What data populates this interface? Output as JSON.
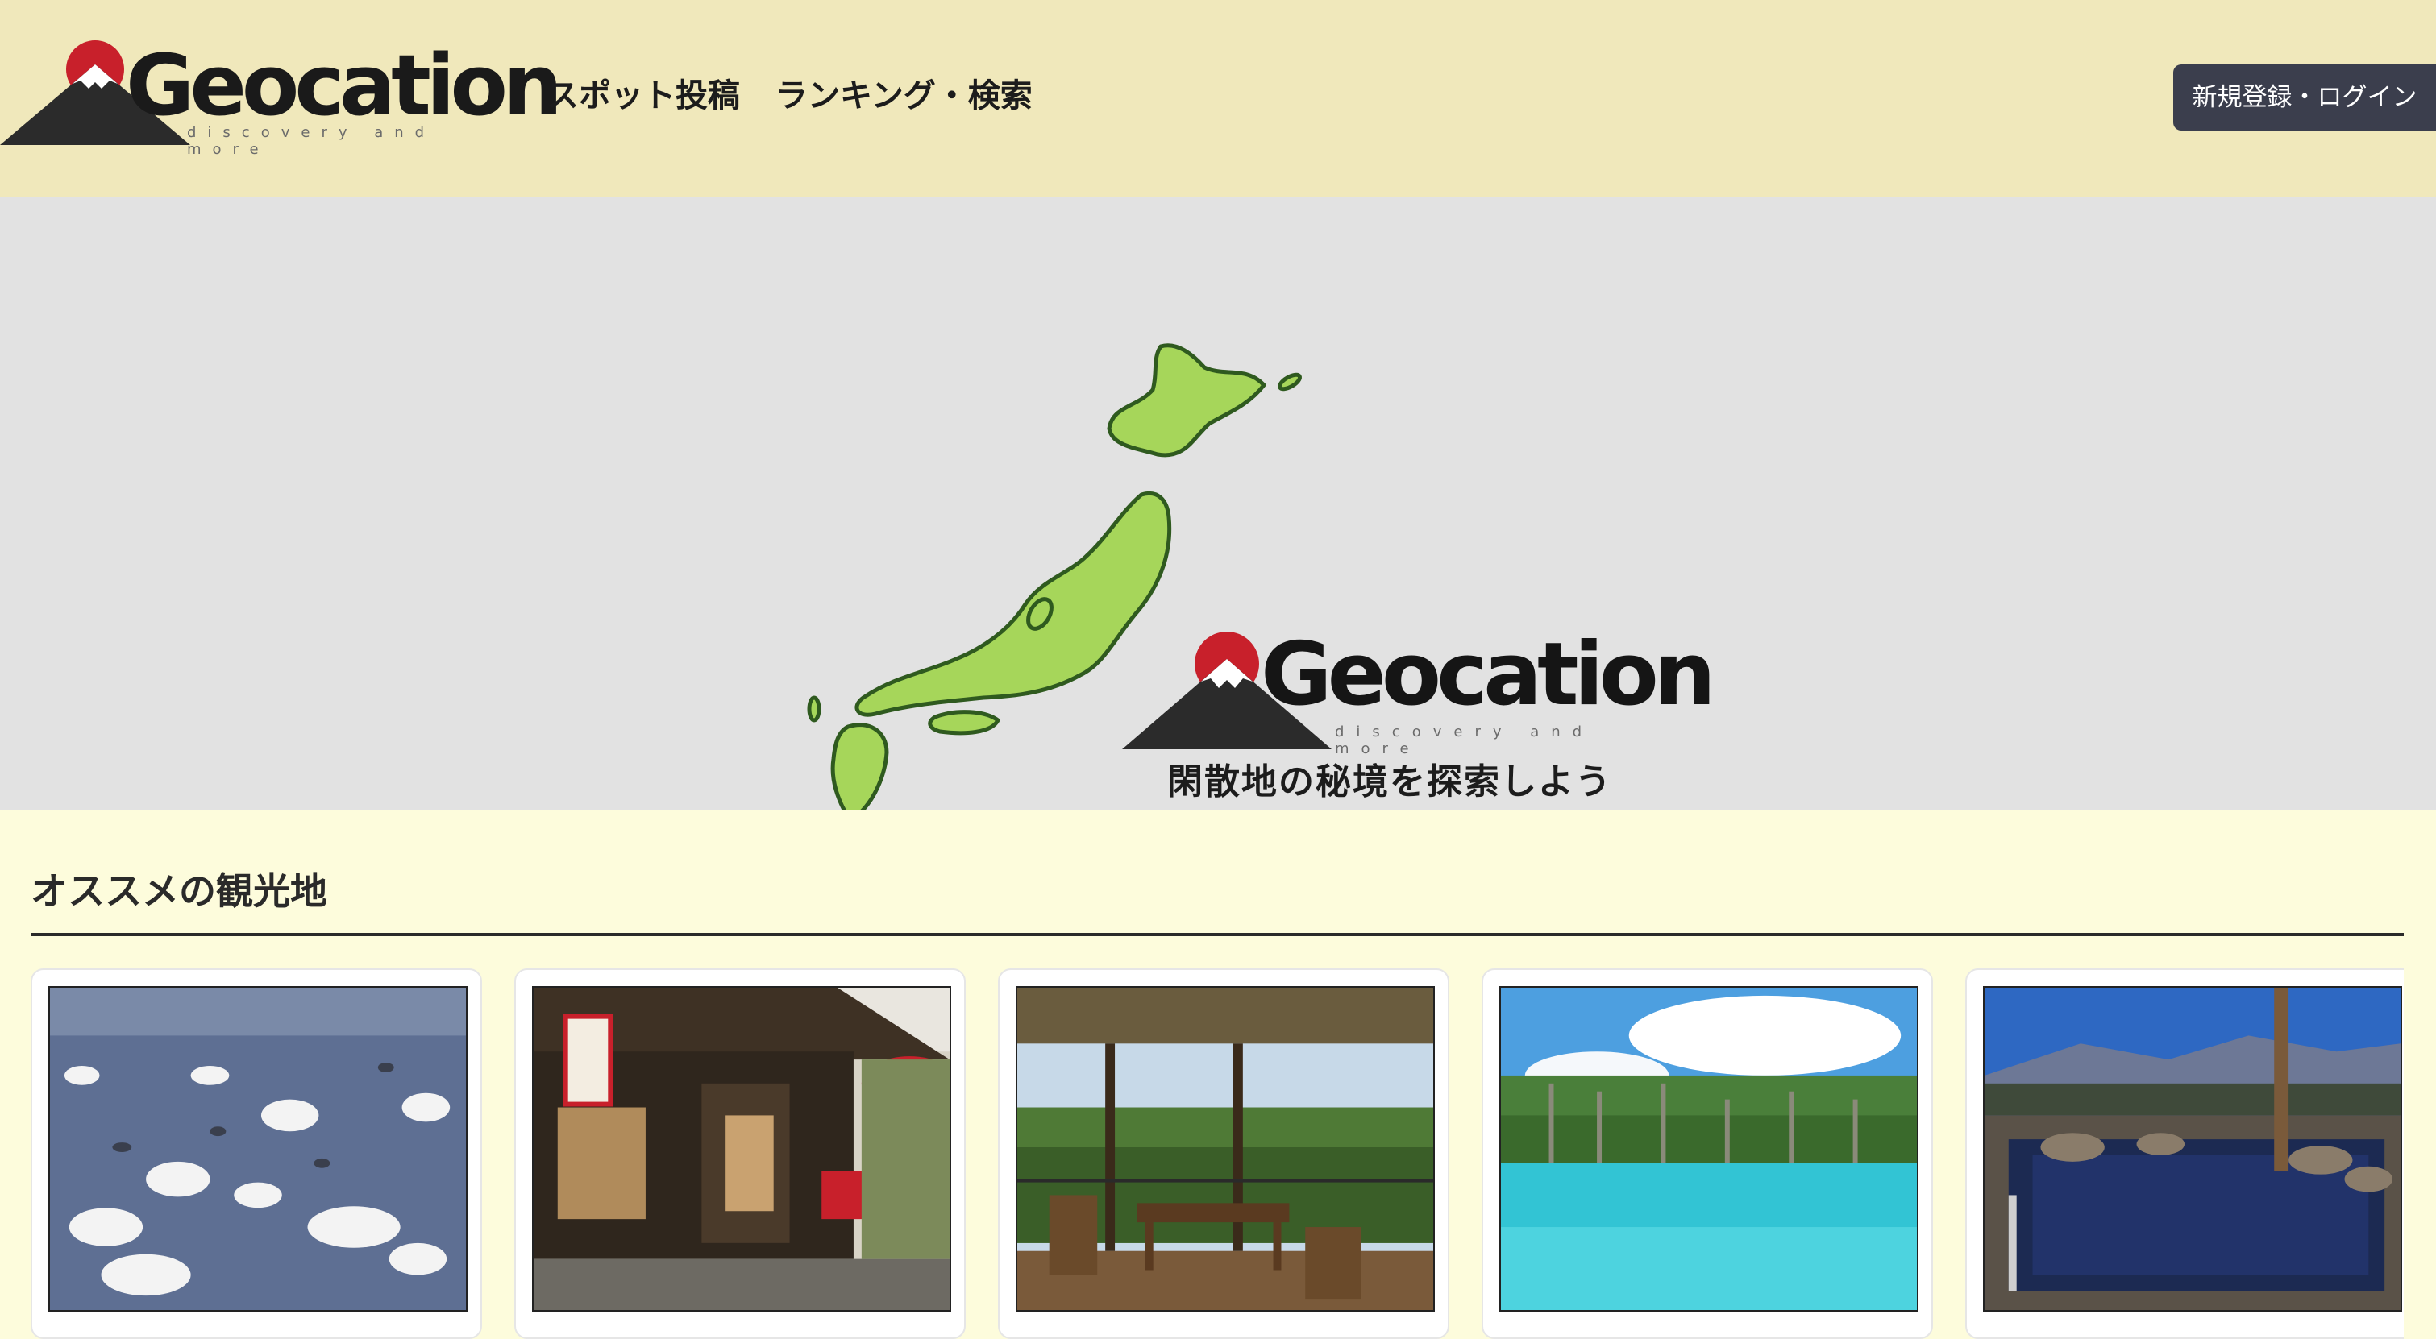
{
  "header": {
    "logo_text": "Geocation",
    "logo_tagline": "discovery and more",
    "nav": [
      {
        "label": "スポット投稿"
      },
      {
        "label": "ランキング・検索"
      }
    ],
    "login_label": "新規登録・ログイン"
  },
  "hero": {
    "logo_text": "Geocation",
    "logo_tagline": "discovery and more",
    "tagline": "閑散地の秘境を探索しよう"
  },
  "recommended": {
    "title": "オススメの観光地",
    "cards": [
      {
        "subject": "swans on lake"
      },
      {
        "subject": "traditional teahouse"
      },
      {
        "subject": "wooden terrace in forest"
      },
      {
        "subject": "blue pond with trees"
      },
      {
        "subject": "open-air hot spring"
      }
    ]
  },
  "colors": {
    "header_bg": "#f0e8bb",
    "hero_bg": "#e2e2e2",
    "section_bg": "#fdfcdc",
    "login_button_bg": "#3b3e4d",
    "brand_red": "#c8202b",
    "map_green": "#a6d65a"
  }
}
